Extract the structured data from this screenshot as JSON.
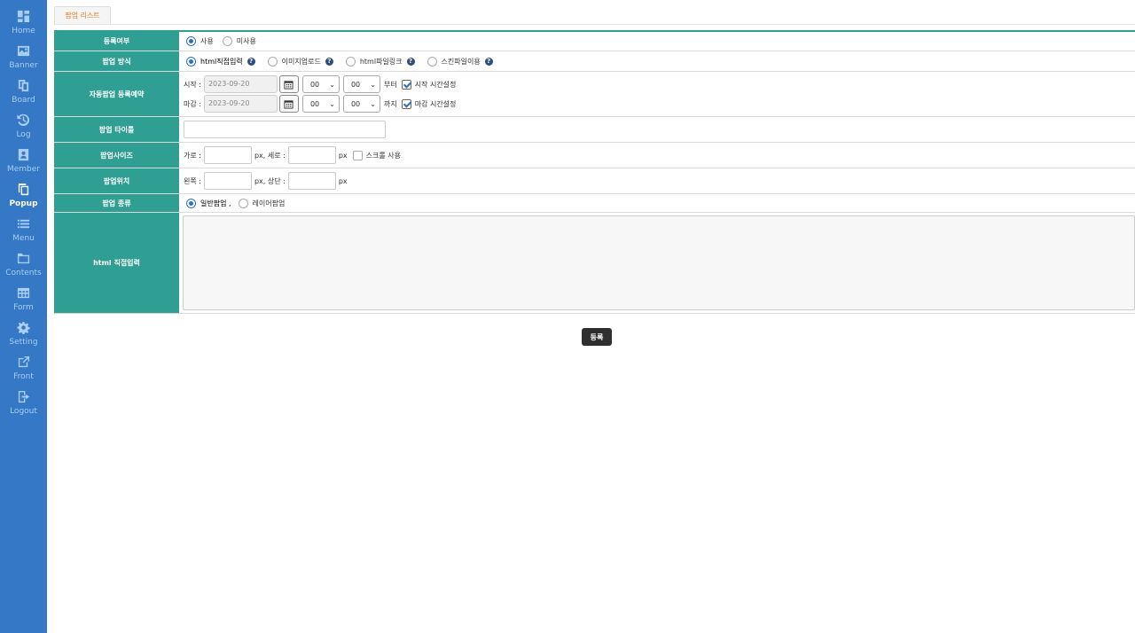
{
  "sidebar": {
    "items": [
      {
        "label": "Home",
        "icon": "dashboard-icon",
        "active": false
      },
      {
        "label": "Banner",
        "icon": "image-icon",
        "active": false
      },
      {
        "label": "Board",
        "icon": "board-icon",
        "active": false
      },
      {
        "label": "Log",
        "icon": "history-icon",
        "active": false
      },
      {
        "label": "Member",
        "icon": "member-icon",
        "active": false
      },
      {
        "label": "Popup",
        "icon": "copy-icon",
        "active": true
      },
      {
        "label": "Menu",
        "icon": "list-icon",
        "active": false
      },
      {
        "label": "Contents",
        "icon": "folder-icon",
        "active": false
      },
      {
        "label": "Form",
        "icon": "table-icon",
        "active": false
      },
      {
        "label": "Setting",
        "icon": "gear-icon",
        "active": false
      },
      {
        "label": "Front",
        "icon": "external-link-icon",
        "active": false
      },
      {
        "label": "Logout",
        "icon": "logout-icon",
        "active": false
      }
    ]
  },
  "tabs": {
    "popup_list": "팝업 리스트"
  },
  "form": {
    "register": {
      "label": "등록여부",
      "options": [
        {
          "text": "사용",
          "checked": true
        },
        {
          "text": "미사용",
          "checked": false
        }
      ]
    },
    "method": {
      "label": "팝업 방식",
      "options": [
        {
          "text": "html직접입력",
          "checked": true
        },
        {
          "text": "이미지업로드",
          "checked": false
        },
        {
          "text": "html파일링크",
          "checked": false
        },
        {
          "text": "스킨파일이용",
          "checked": false
        }
      ],
      "help": "?"
    },
    "schedule": {
      "label": "자동팝업 등록예약",
      "start": {
        "prefix": "시작 :",
        "date": "2023-09-20",
        "hour": "00",
        "minute": "00",
        "suffix": "부터",
        "check_label": "시작 시간설정",
        "checked": true
      },
      "end": {
        "prefix": "마감 :",
        "date": "2023-09-20",
        "hour": "00",
        "minute": "00",
        "suffix": "까지",
        "check_label": "마감 시간설정",
        "checked": true
      }
    },
    "title": {
      "label": "팝업 타이틀",
      "value": ""
    },
    "size": {
      "label": "팝업사이즈",
      "width_prefix": "가로 :",
      "px1": "px, 세로 :",
      "px2": "px",
      "scroll_label": "스크롤 사용",
      "scroll_checked": false
    },
    "position": {
      "label": "팝업위치",
      "left_prefix": "왼쪽 :",
      "px1": "px, 상단 :",
      "px2": "px"
    },
    "kind": {
      "label": "팝업 종류",
      "options": [
        {
          "text": "일반팝업 ,",
          "checked": true
        },
        {
          "text": "레이어팝업",
          "checked": false
        }
      ]
    },
    "html": {
      "label": "html 직접입력",
      "value": ""
    }
  },
  "submit": "등록",
  "colors": {
    "sidebar": "#3478c6",
    "header_cell": "#2e9f92",
    "button": "#2f2f2f",
    "tab_text": "#e67e22"
  }
}
